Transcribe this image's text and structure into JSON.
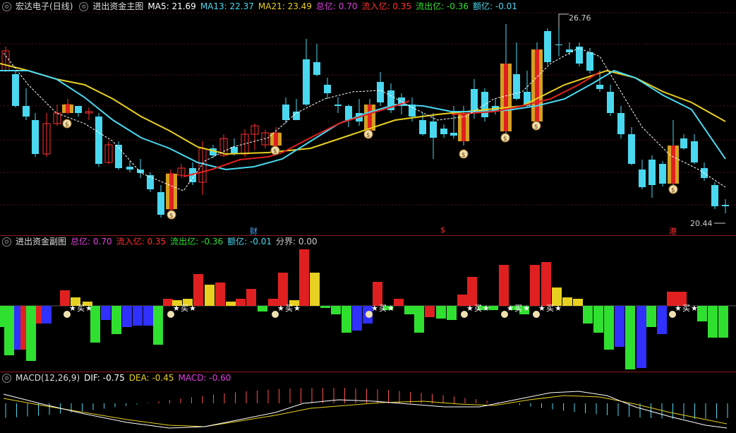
{
  "main": {
    "stock_name": "宏达电子",
    "period": "(日线)",
    "indicator": "进出资金主图",
    "legend": [
      {
        "label": "MA5: 21.69",
        "color": "#ffffff"
      },
      {
        "label": "MA13: 22.37",
        "color": "#4ad8f0"
      },
      {
        "label": "MA21: 23.49",
        "color": "#e8d020"
      },
      {
        "label": "总亿: 0.70",
        "color": "#e040e0"
      },
      {
        "label": "流入亿: 0.35",
        "color": "#ff3030"
      },
      {
        "label": "流出亿: -0.36",
        "color": "#30e030"
      },
      {
        "label": "额亿: -0.01",
        "color": "#4ad8f0"
      }
    ],
    "high_label": "26.76",
    "low_label": "20.44",
    "markers": [
      {
        "text": "财",
        "color": "#4aa8ff"
      },
      {
        "text": "$",
        "color": "#ff3030"
      },
      {
        "text": "港",
        "color": "#ff3030"
      }
    ],
    "money_icon": "money-bag-icon"
  },
  "sub": {
    "title": "进出资金副图",
    "legend": [
      {
        "label": "总亿: 0.70",
        "color": "#e040e0"
      },
      {
        "label": "流入亿: 0.35",
        "color": "#ff3030"
      },
      {
        "label": "流出亿: -0.36",
        "color": "#30e030"
      },
      {
        "label": "额亿: -0.01",
        "color": "#4ad8f0"
      },
      {
        "label": "分界: 0.00",
        "color": "#cccccc"
      }
    ],
    "buy_label": "买",
    "star_icon": "star-icon"
  },
  "macd": {
    "title": "MACD(12,26,9)",
    "legend": [
      {
        "label": "DIF: -0.75",
        "color": "#ffffff"
      },
      {
        "label": "DEA: -0.45",
        "color": "#e8d020"
      },
      {
        "label": "MACD: -0.60",
        "color": "#e040e0"
      }
    ]
  }
}
